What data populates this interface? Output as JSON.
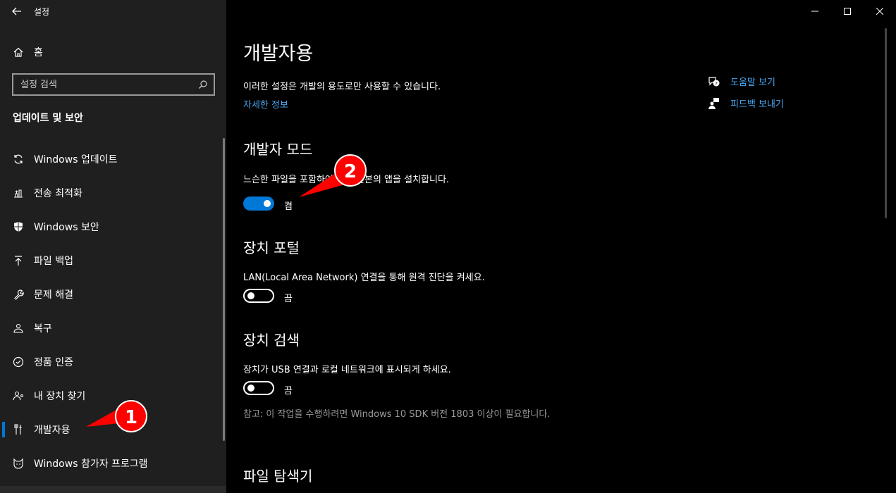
{
  "window": {
    "title": "설정"
  },
  "sidebar": {
    "home_label": "홈",
    "search_placeholder": "설정 검색",
    "section_title": "업데이트 및 보안",
    "items": [
      {
        "label": "Windows 업데이트",
        "icon": "refresh-icon"
      },
      {
        "label": "전송 최적화",
        "icon": "delivery-optimization-icon"
      },
      {
        "label": "Windows 보안",
        "icon": "shield-icon"
      },
      {
        "label": "파일 백업",
        "icon": "backup-arrow-icon"
      },
      {
        "label": "문제 해결",
        "icon": "wrench-icon"
      },
      {
        "label": "복구",
        "icon": "recovery-icon"
      },
      {
        "label": "정품 인증",
        "icon": "check-circle-icon"
      },
      {
        "label": "내 장치 찾기",
        "icon": "person-pin-icon"
      },
      {
        "label": "개발자용",
        "icon": "developer-tools-icon",
        "active": true
      },
      {
        "label": "Windows 참가자 프로그램",
        "icon": "insider-cat-icon"
      }
    ]
  },
  "main": {
    "title": "개발자용",
    "description": "이러한 설정은 개발의 용도로만 사용할 수 있습니다.",
    "more_info_link": "자세한 정보",
    "developer_mode": {
      "heading": "개발자 모드",
      "description": "느슨한 파일을 포함하여 모든 원본의 앱을 설치합니다.",
      "state_label": "켬"
    },
    "device_portal": {
      "heading": "장치 포털",
      "description": "LAN(Local Area Network) 연결을 통해 원격 진단을 켜세요.",
      "state_label": "끔"
    },
    "device_discovery": {
      "heading": "장치 검색",
      "description": "장치가 USB 연결과 로컬 네트워크에 표시되게 하세요.",
      "state_label": "끔",
      "note": "참고: 이 작업을 수행하려면 Windows 10 SDK 버전 1803 이상이 필요합니다."
    },
    "file_explorer": {
      "heading": "파일 탐색기"
    }
  },
  "help": {
    "get_help": "도움말 보기",
    "feedback": "피드백 보내기"
  },
  "annotations": {
    "marker_1": "1",
    "marker_2": "2"
  },
  "colors": {
    "accent": "#0078d7",
    "link": "#4aa6f0",
    "annotation_red": "#ff0000"
  }
}
